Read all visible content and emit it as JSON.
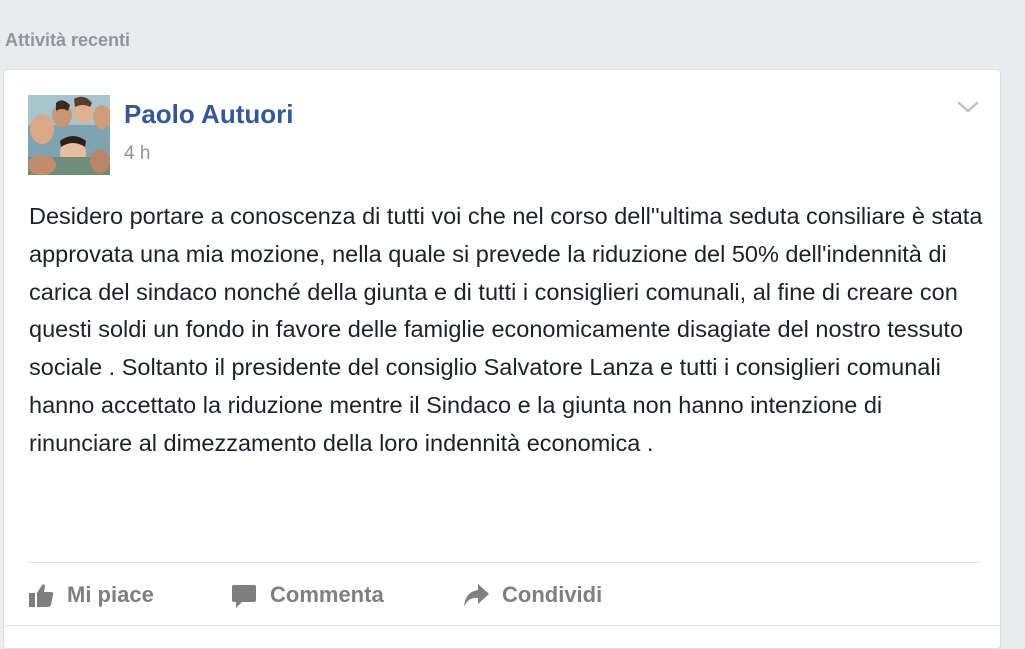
{
  "section": {
    "title": "Attività recenti"
  },
  "post": {
    "author": "Paolo Autuori",
    "time": "4 h",
    "body": "Desidero portare a conoscenza di tutti voi che nel corso dell''ultima seduta consiliare è stata approvata una mia mozione, nella quale si prevede la riduzione del 50% dell'indennità di carica del sindaco nonché della giunta e di tutti i consiglieri comunali, al fine di creare con questi soldi un fondo in favore delle famiglie economicamente disagiate del nostro tessuto sociale . Soltanto il presidente del consiglio Salvatore Lanza e tutti i consiglieri comunali hanno accettato la riduzione mentre il Sindaco e la giunta non hanno intenzione di rinunciare al dimezzamento della loro indennità economica ."
  },
  "actions": {
    "like": {
      "label": "Mi piace",
      "icon": "thumbs-up-icon"
    },
    "comment": {
      "label": "Commenta",
      "icon": "comment-bubble-icon"
    },
    "share": {
      "label": "Condividi",
      "icon": "share-arrow-icon"
    }
  },
  "colors": {
    "author": "#365899",
    "muted": "#90949c",
    "text": "#1d2129",
    "action": "#7f7f7f",
    "background": "#e9ebee"
  }
}
